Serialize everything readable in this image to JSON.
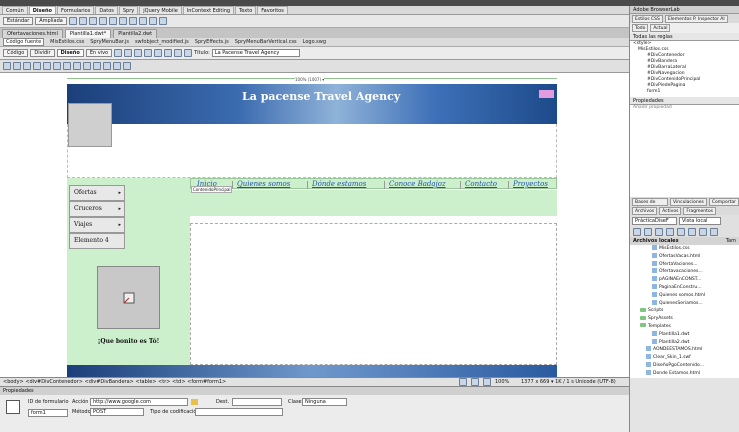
{
  "app": {
    "menu_bar": ""
  },
  "insert_tabs": [
    {
      "label": "Común",
      "active": false
    },
    {
      "label": "Diseño",
      "active": true
    },
    {
      "label": "Formularios",
      "active": false
    },
    {
      "label": "Datos",
      "active": false
    },
    {
      "label": "Spry",
      "active": false
    },
    {
      "label": "jQuery Mobile",
      "active": false
    },
    {
      "label": "InContext Editing",
      "active": false
    },
    {
      "label": "Texto",
      "active": false
    },
    {
      "label": "Favoritos",
      "active": false
    }
  ],
  "insert_bar": {
    "standard": "Estándar",
    "expanded": "Ampliada"
  },
  "doc_tabs": [
    {
      "label": "Ofertavaciones.html",
      "active": false
    },
    {
      "label": "Plantilla1.dwt*",
      "active": true
    },
    {
      "label": "Plantilla2.dwt",
      "active": false
    }
  ],
  "related_files": [
    {
      "label": "Código fuente",
      "active": true
    },
    {
      "label": "MisEstilos.css",
      "active": false
    },
    {
      "label": "SpryMenuBar.js",
      "active": false
    },
    {
      "label": "swfobject_modified.js",
      "active": false
    },
    {
      "label": "SpryEffects.js",
      "active": false
    },
    {
      "label": "SpryMenuBarVertical.css",
      "active": false
    },
    {
      "label": "Logo.swg",
      "active": false
    }
  ],
  "doc_toolbar": {
    "code": "Código",
    "split": "Dividir",
    "design": "Diseño",
    "live": "En vivo",
    "title_label": "Título:",
    "title_value": "La Pacense Travel Agency"
  },
  "canvas": {
    "ruler_label": "100% (1007) ▾",
    "banner_title": "La pacense Travel Agency",
    "nav": [
      "Inicio",
      "Quienes somos",
      "Dónde estamos",
      "Conoce Badajoz",
      "Contacto",
      "Proyectos"
    ],
    "content_label": "ContenidoPrincipal",
    "side_menu": [
      {
        "label": "Ofertas",
        "arrow": "▸"
      },
      {
        "label": "Cruceros",
        "arrow": "▸"
      },
      {
        "label": "Viajes",
        "arrow": "▸"
      },
      {
        "label": "Elemento 4",
        "arrow": ""
      }
    ],
    "caption": "¡Que bonito es Tó!"
  },
  "tag_bar": {
    "path": "<body> <div#DivContenedor> <div#DivBandera> <table> <tr> <td> <form#form1>",
    "zoom": "100%",
    "size": "1377 x 669 ▾ 1K / 1 s Unicode (UTF-8)"
  },
  "properties": {
    "title": "Propiedades",
    "form_id_label": "ID de formulario",
    "form_id": "form1",
    "action_label": "Acción",
    "action": "http://www.google.com",
    "method_label": "Método",
    "method": "POST",
    "dest_label": "Dest.",
    "enctype_label": "Tipo de codificación",
    "class_label": "Clase",
    "class": "Ninguna"
  },
  "right_panel": {
    "header": "Adobe BrowserLab",
    "css_tabs": [
      "Estilos CSS",
      "Elementos P. Inspector Al"
    ],
    "subtabs": [
      "Todo",
      "Actual"
    ],
    "rules_title": "Todas las reglas",
    "rules": [
      "<style>",
      "MisEstilos.css",
      "#DivContenedor",
      "#DivBandera",
      "#DivBarraLateral",
      "#DivNavegacion",
      "#DivContenidoPrincipal",
      "#DivPiedePagina",
      "form1"
    ],
    "props_title": "Propiedades",
    "props_add": "Añadir propiedad",
    "db_tabs": [
      "Bases de datos",
      "Vinculaciones",
      "Comportar"
    ],
    "files_tabs": [
      "Archivos",
      "Activos",
      "Fragmentos"
    ],
    "site": "PrácticaDiseF",
    "view": "Vista local",
    "local_title": "Archivos locales",
    "size_col": "Tam",
    "files": [
      {
        "name": "MisEstilos.css",
        "indent": 3,
        "type": "file"
      },
      {
        "name": "OfertasVacas.html",
        "indent": 3,
        "type": "file"
      },
      {
        "name": "OfertaVaciones...",
        "indent": 3,
        "type": "file"
      },
      {
        "name": "Ofertavacaciones...",
        "indent": 3,
        "type": "file"
      },
      {
        "name": "pAGINAEnCONST...",
        "indent": 3,
        "type": "file"
      },
      {
        "name": "PaginaEnConstru...",
        "indent": 3,
        "type": "file"
      },
      {
        "name": "Quienes somos.html",
        "indent": 3,
        "type": "file"
      },
      {
        "name": "QuienesSeriamos...",
        "indent": 3,
        "type": "file"
      },
      {
        "name": "Scripts",
        "indent": 1,
        "type": "folder"
      },
      {
        "name": "SpryAssets",
        "indent": 1,
        "type": "folder"
      },
      {
        "name": "Templates",
        "indent": 1,
        "type": "folder"
      },
      {
        "name": "Plantilla1.dwt",
        "indent": 3,
        "type": "file"
      },
      {
        "name": "Plantilla2.dwt",
        "indent": 3,
        "type": "file"
      },
      {
        "name": "AONDEESTAMOS.html",
        "indent": 2,
        "type": "file"
      },
      {
        "name": "Clear_Skin_1.swf",
        "indent": 2,
        "type": "file"
      },
      {
        "name": "DiseñoPgoContenido...",
        "indent": 2,
        "type": "file"
      },
      {
        "name": "Donde Estamos.html",
        "indent": 2,
        "type": "file"
      }
    ]
  }
}
